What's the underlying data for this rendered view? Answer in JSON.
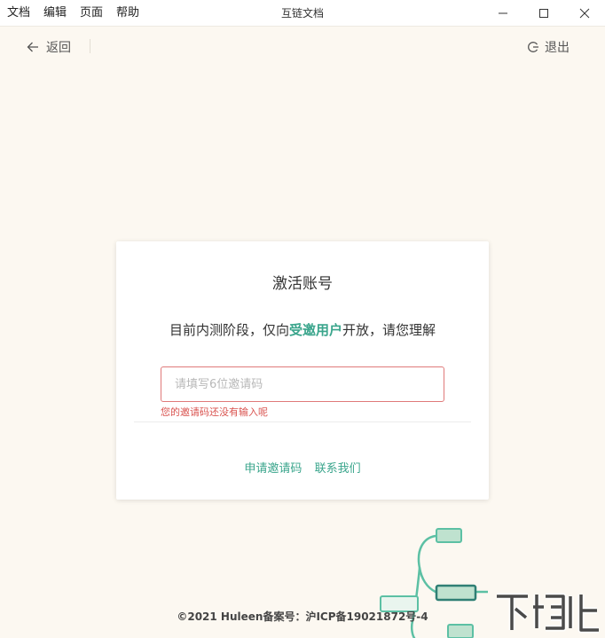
{
  "menu": [
    "文档",
    "编辑",
    "页面",
    "帮助"
  ],
  "window": {
    "title": "互链文档"
  },
  "nav": {
    "back_label": "返回",
    "logout_label": "退出"
  },
  "card": {
    "title": "激活账号",
    "desc_prefix": "目前内测阶段，仅向",
    "desc_highlight": "受邀用户",
    "desc_suffix": "开放，请您理解",
    "input_placeholder": "请填写6位邀请码",
    "input_value": "",
    "error_text": "您的邀请码还没有输入呢",
    "link_apply": "申请邀请码",
    "link_contact": "联系我们"
  },
  "footer": {
    "text": "©2021 Huleen备案号：沪ICP备19021872号-4"
  },
  "colors": {
    "accent": "#3aa58c",
    "error": "#d9534f",
    "background": "#fcf8f1"
  }
}
